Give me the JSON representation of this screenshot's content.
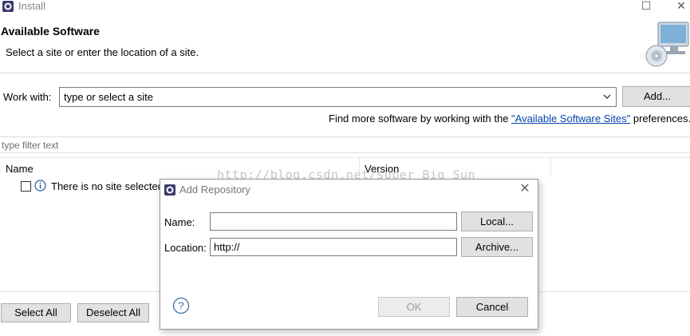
{
  "window": {
    "title": "Install",
    "minimize_glyph": "—",
    "maximize_glyph": "☐",
    "close_glyph": "✕"
  },
  "header": {
    "title": "Available Software",
    "subtitle": "Select a site or enter the location of a site."
  },
  "work_with": {
    "label": "Work with:",
    "combo_value": "type or select a site",
    "add_button": "Add...",
    "hint_prefix": "Find more software by working with the ",
    "hint_link": "\"Available Software Sites\"",
    "hint_suffix": " preferences."
  },
  "filter": {
    "placeholder": "type filter text"
  },
  "table": {
    "columns": [
      "Name",
      "Version"
    ],
    "rows": [
      {
        "name": "There is no site selected."
      }
    ]
  },
  "footer": {
    "select_all": "Select All",
    "deselect_all": "Deselect All"
  },
  "watermark": "http://blog.csdn.net/super_Big_Sun",
  "dialog": {
    "title": "Add Repository",
    "name_label": "Name:",
    "name_value": "",
    "location_label": "Location:",
    "location_value": "http://",
    "local_button": "Local...",
    "archive_button": "Archive...",
    "ok_button": "OK",
    "cancel_button": "Cancel",
    "help_glyph": "?"
  },
  "colors": {
    "link": "#0645ad",
    "button_face": "#e1e1e1",
    "disabled_text": "#9a9a9a"
  }
}
